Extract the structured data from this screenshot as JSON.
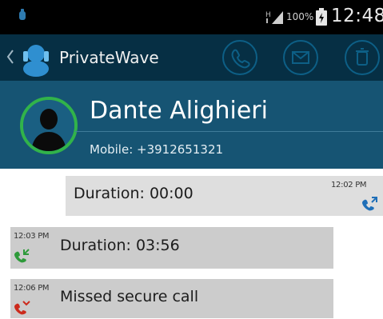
{
  "status_bar": {
    "battery_percent": "100%",
    "time": "12:48"
  },
  "action_bar": {
    "app_title": "PrivateWave",
    "buttons": [
      {
        "name": "call-button",
        "icon": "phone-icon"
      },
      {
        "name": "message-button",
        "icon": "envelope-icon"
      },
      {
        "name": "delete-button",
        "icon": "trash-icon"
      }
    ]
  },
  "contact": {
    "name": "Dante Alighieri",
    "phone": "Mobile: +3912651321",
    "avatar_ring_color": "#31b34a"
  },
  "call_log": [
    {
      "text": "Duration: 00:00",
      "time": "12:02 PM",
      "direction": "outgoing",
      "icon": "outgoing-call-icon",
      "icon_color": "#1f6fb8"
    },
    {
      "text": "Duration: 03:56",
      "time": "12:03 PM",
      "direction": "incoming",
      "icon": "incoming-call-icon",
      "icon_color": "#2e9a3a"
    },
    {
      "text": "Missed secure call",
      "time": "12:06 PM",
      "direction": "missed",
      "icon": "missed-call-icon",
      "icon_color": "#cc2a1c"
    }
  ],
  "colors": {
    "status_bar": "#000000",
    "action_bar": "#062f44",
    "contact_header": "#165473",
    "accent_ring": "#0d5f86"
  }
}
